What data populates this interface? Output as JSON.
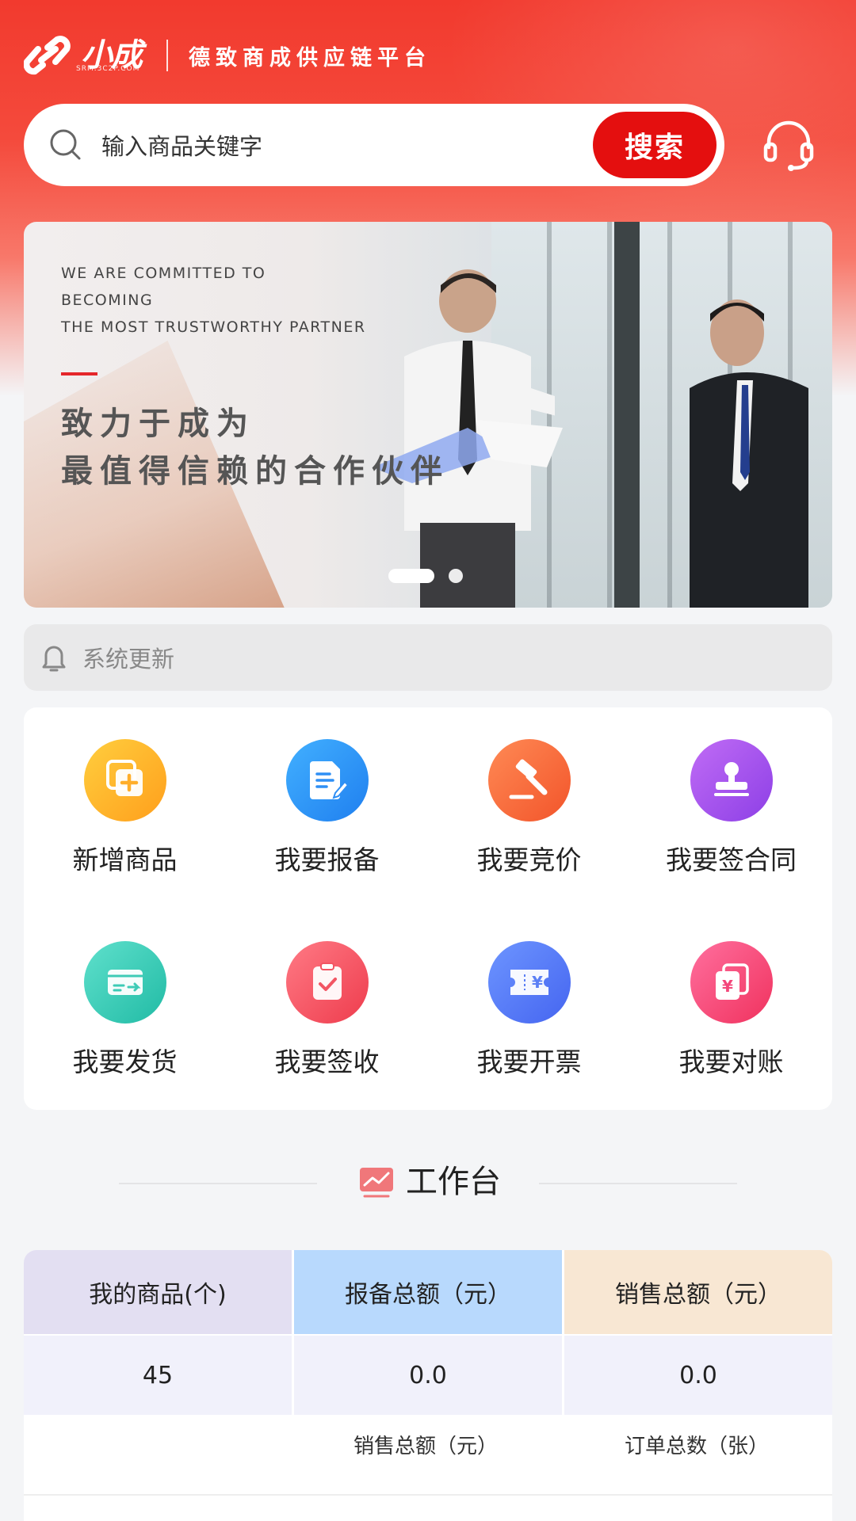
{
  "header": {
    "logo_text": "小成",
    "logo_sub": "SRM.3C2P.COM",
    "title": "德致商成供应链平台"
  },
  "search": {
    "placeholder": "输入商品关键字",
    "button_label": "搜索",
    "support_icon": "headset-icon"
  },
  "banner": {
    "en_lines": [
      "WE ARE COMMITTED TO",
      "BECOMING",
      "THE MOST TRUSTWORTHY PARTNER"
    ],
    "cn_lines": [
      "致力于成为",
      "最值得信赖的合作伙伴"
    ],
    "slide_count": 2,
    "active_slide": 1
  },
  "notice": {
    "icon": "bell-icon",
    "text": "系统更新"
  },
  "shortcuts": [
    {
      "label": "新增商品",
      "icon": "add-product-icon",
      "color_from": "#ffce3e",
      "color_to": "#ff9f1c"
    },
    {
      "label": "我要报备",
      "icon": "document-edit-icon",
      "color_from": "#42b0ff",
      "color_to": "#1f7fef"
    },
    {
      "label": "我要竞价",
      "icon": "auction-hammer-icon",
      "color_from": "#ff8a55",
      "color_to": "#f2542a"
    },
    {
      "label": "我要签合同",
      "icon": "stamp-icon",
      "color_from": "#c06cf5",
      "color_to": "#8d3fe6"
    },
    {
      "label": "我要发货",
      "icon": "shipping-card-icon",
      "color_from": "#5fe0cc",
      "color_to": "#21bba5"
    },
    {
      "label": "我要签收",
      "icon": "clipboard-check-icon",
      "color_from": "#ff7a85",
      "color_to": "#ee3c4d"
    },
    {
      "label": "我要开票",
      "icon": "invoice-ticket-icon",
      "color_from": "#6d95ff",
      "color_to": "#4565f0"
    },
    {
      "label": "我要对账",
      "icon": "reconcile-icon",
      "color_from": "#ff6f9e",
      "color_to": "#f0325e"
    }
  ],
  "workbench": {
    "title": "工作台",
    "icon": "chart-icon",
    "columns": [
      {
        "header": "我的商品(个)",
        "value": "45",
        "header_bg": "#e3dff2"
      },
      {
        "header": "报备总额（元）",
        "value": "0.0",
        "header_bg": "#b8d9fd"
      },
      {
        "header": "销售总额（元）",
        "value": "0.0",
        "header_bg": "#f8e7d3"
      }
    ],
    "sub_headers": [
      "销售总额（元）",
      "订单总数（张）"
    ]
  }
}
